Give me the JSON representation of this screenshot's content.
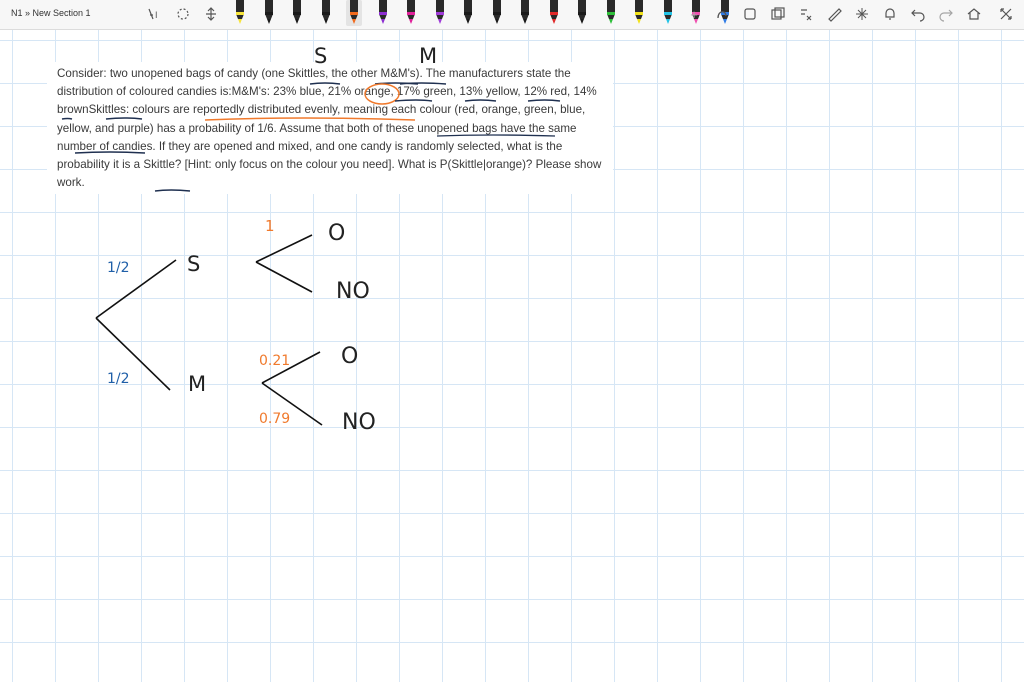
{
  "breadcrumb": "N1 » New Section 1",
  "toolbar": {
    "pens": [
      {
        "name": "pen-yellow-highlighter",
        "color": "#f7e43c"
      },
      {
        "name": "pen-black-1",
        "color": "#1a1a1a"
      },
      {
        "name": "pen-black-2",
        "color": "#1a1a1a"
      },
      {
        "name": "pen-black-3",
        "color": "#1a1a1a"
      },
      {
        "name": "pen-orange",
        "color": "#f26b1d"
      },
      {
        "name": "pen-purple-1",
        "color": "#8d2fd1"
      },
      {
        "name": "pen-magenta",
        "color": "#e0209a"
      },
      {
        "name": "pen-purple-2",
        "color": "#9f3ad8"
      },
      {
        "name": "pen-black-4",
        "color": "#1a1a1a"
      },
      {
        "name": "pen-black-5",
        "color": "#1a1a1a"
      },
      {
        "name": "pen-black-6",
        "color": "#1a1a1a"
      },
      {
        "name": "pen-red",
        "color": "#e02b2b"
      },
      {
        "name": "pen-black-7",
        "color": "#1a1a1a"
      },
      {
        "name": "pen-green",
        "color": "#2fbf3a"
      },
      {
        "name": "pen-yellow",
        "color": "#f2e21a"
      },
      {
        "name": "pen-cyan",
        "color": "#22c3e6"
      },
      {
        "name": "pen-pink",
        "color": "#f04fb0"
      },
      {
        "name": "pen-blue",
        "color": "#2f7be5"
      }
    ]
  },
  "problem_text": "Consider: two unopened bags of candy (one Skittles, the other M&M's). The manufacturers state the distribution of coloured candies is:M&M's: 23% blue, 21% orange, 17% green, 13% yellow, 12% red, 14% brownSkittles: colours are reportedly distributed evenly, meaning each colour (red, orange, green, blue, yellow, and purple) has a probability of 1/6. Assume that both of these unopened bags have the same number of candies. If they are opened and mixed, and one candy is randomly selected, what is the probability it is a Skittle? [Hint: only focus on the colour you need]. What is P(Skittle|orange)? Please show work.",
  "ink": {
    "header_S": "S",
    "header_M": "M",
    "branch_S_prob": "1/2",
    "branch_M_prob": "1/2",
    "node_S": "S",
    "node_M": "M",
    "S_orange_prob": "1",
    "M_orange_prob": "0.21",
    "M_not_orange_prob": "0.79",
    "leaf_O_1": "O",
    "leaf_NO_1": "NO",
    "leaf_O_2": "O",
    "leaf_NO_2": "NO"
  }
}
